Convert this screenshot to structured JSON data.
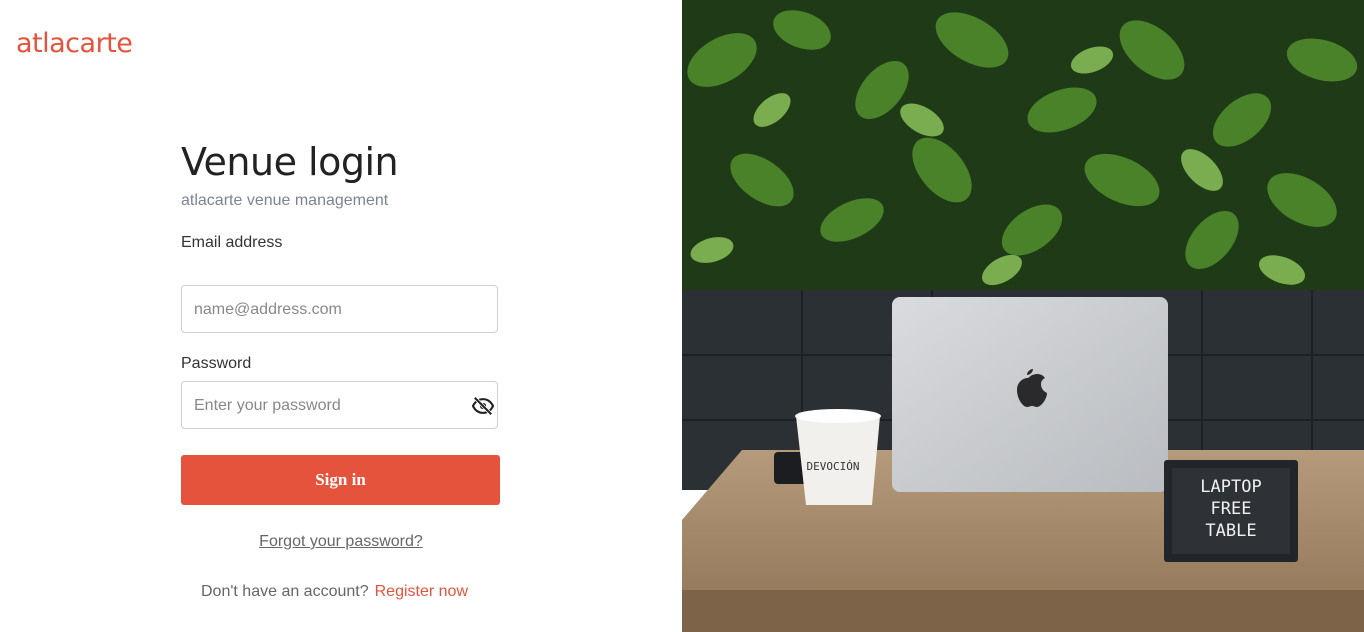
{
  "brand": {
    "logo_text": "atlacarte",
    "accent_color": "#e5533c"
  },
  "page": {
    "title": "Venue login",
    "subtitle": "atlacarte venue management"
  },
  "form": {
    "email": {
      "label": "Email address",
      "placeholder": "name@address.com"
    },
    "password": {
      "label": "Password",
      "placeholder": "Enter your password",
      "toggle_icon": "eye-off-icon"
    },
    "submit_label": "Sign in",
    "forgot_link": "Forgot your password?",
    "register_prompt": "Don't have an account?",
    "register_link": "Register now"
  },
  "hero": {
    "sign_lines": [
      "LAPTOP",
      "FREE",
      "TABLE"
    ],
    "cup_text": "DEVOCIÓN"
  }
}
